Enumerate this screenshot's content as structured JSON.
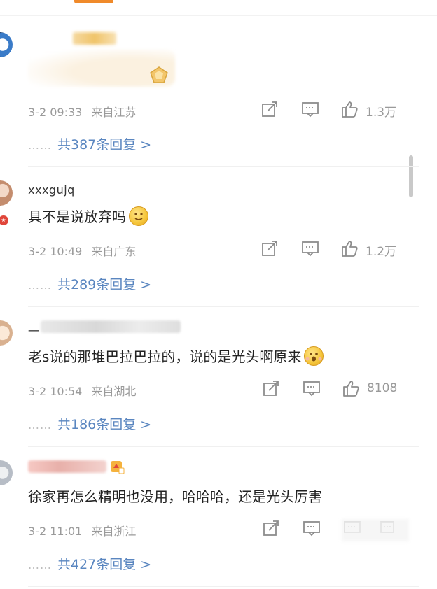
{
  "comments": [
    {
      "username": "",
      "text": "",
      "time": "3-2 09:33",
      "location": "来自江苏",
      "likes": "1.3万",
      "replies_label": "共387条回复 >",
      "replies_dots": "……"
    },
    {
      "username": "xxxgujq",
      "text": "具不是说放弃吗",
      "time": "3-2 10:49",
      "location": "来自广东",
      "likes": "1.2万",
      "replies_label": "共289条回复 >",
      "replies_dots": "……"
    },
    {
      "username": "一",
      "text": "老s说的那堆巴拉巴拉的，说的是光头啊原来",
      "time": "3-2 10:54",
      "location": "来自湖北",
      "likes": "8108",
      "replies_label": "共186条回复 >",
      "replies_dots": "……"
    },
    {
      "username": "",
      "text": "徐家再怎么精明也没用，哈哈哈，还是光头厉害",
      "time": "3-2 11:01",
      "location": "来自浙江",
      "likes": "",
      "replies_label": "共427条回复 >",
      "replies_dots": "……"
    }
  ],
  "icons": {
    "share": "share-icon",
    "comment": "comment-icon",
    "like": "thumbs-up-icon",
    "smile": "smile-emoji",
    "surprised": "surprised-emoji"
  },
  "colors": {
    "link": "#5a86c0",
    "meta": "#9a9a9a",
    "tab_accent": "#f08a2a"
  }
}
